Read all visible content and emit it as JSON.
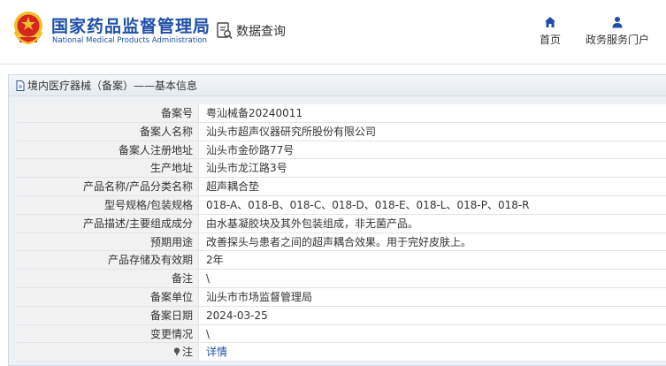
{
  "header": {
    "brand_cn": "国家药品监督管理局",
    "brand_en": "National Medical Products Administration",
    "query_label": "数据查询",
    "nav": [
      {
        "label": "首页",
        "icon": "home-icon"
      },
      {
        "label": "政务服务门户",
        "icon": "user-icon"
      }
    ]
  },
  "panel": {
    "title": "境内医疗器械（备案）——基本信息"
  },
  "rows": [
    {
      "key": "备案号",
      "value": "粤汕械备20240011"
    },
    {
      "key": "备案人名称",
      "value": "汕头市超声仪器研究所股份有限公司"
    },
    {
      "key": "备案人注册地址",
      "value": "汕头市金砂路77号"
    },
    {
      "key": "生产地址",
      "value": "汕头市龙江路3号"
    },
    {
      "key": "产品名称/产品分类名称",
      "value": "超声耦合垫"
    },
    {
      "key": "型号规格/包装规格",
      "value": "018-A、018-B、018-C、018-D、018-E、018-L、018-P、018-R"
    },
    {
      "key": "产品描述/主要组成成分",
      "value": "由水基凝胶块及其外包装组成，非无菌产品。"
    },
    {
      "key": "预期用途",
      "value": "改善探头与患者之间的超声耦合效果。用于完好皮肤上。"
    },
    {
      "key": "产品存储及有效期",
      "value": "2年"
    },
    {
      "key": "备注",
      "value": "\\"
    },
    {
      "key": "备案单位",
      "value": "汕头市市场监督管理局"
    },
    {
      "key": "备案日期",
      "value": "2024-03-25"
    },
    {
      "key": "变更情况",
      "value": "\\"
    },
    {
      "key": "注",
      "value": "详情"
    }
  ],
  "colors": {
    "brand_blue": "#1e4fa8",
    "logo_red": "#d7261e",
    "logo_gold": "#f2c02c"
  }
}
